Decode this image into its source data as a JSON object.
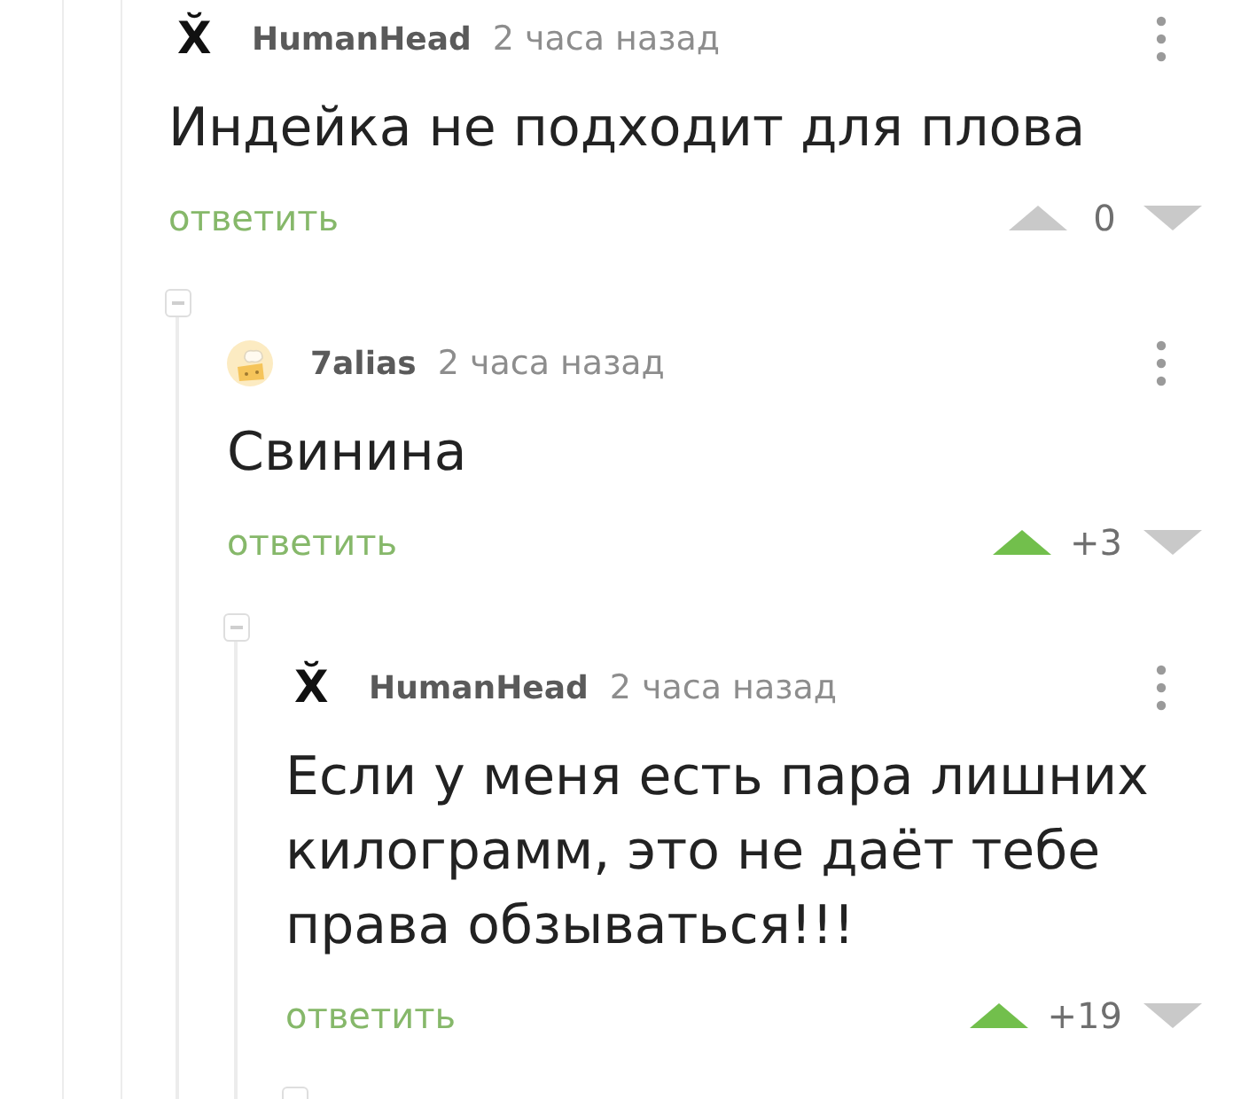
{
  "comments": [
    {
      "avatar": {
        "kind": "glyph",
        "glyph": "X̆"
      },
      "author": "HumanHead",
      "time": "2 часа назад",
      "text": "Индейка не подходит для плова",
      "reply": "ответить",
      "rating": "0",
      "upvoted": false,
      "downvoted": false,
      "expanded": true,
      "children": [
        {
          "avatar": {
            "kind": "image"
          },
          "author": "7alias",
          "time": "2 часа назад",
          "text": "Свинина",
          "reply": "ответить",
          "rating": "+3",
          "upvoted": true,
          "downvoted": false,
          "expanded": true,
          "children": [
            {
              "avatar": {
                "kind": "glyph",
                "glyph": "X̆"
              },
              "author": "HumanHead",
              "time": "2 часа назад",
              "text": "Если у меня есть пара лишних килограмм, это не даёт тебе права обзываться!!!",
              "reply": "ответить",
              "rating": "+19",
              "upvoted": true,
              "downvoted": false,
              "expanded": true
            }
          ]
        }
      ]
    }
  ]
}
